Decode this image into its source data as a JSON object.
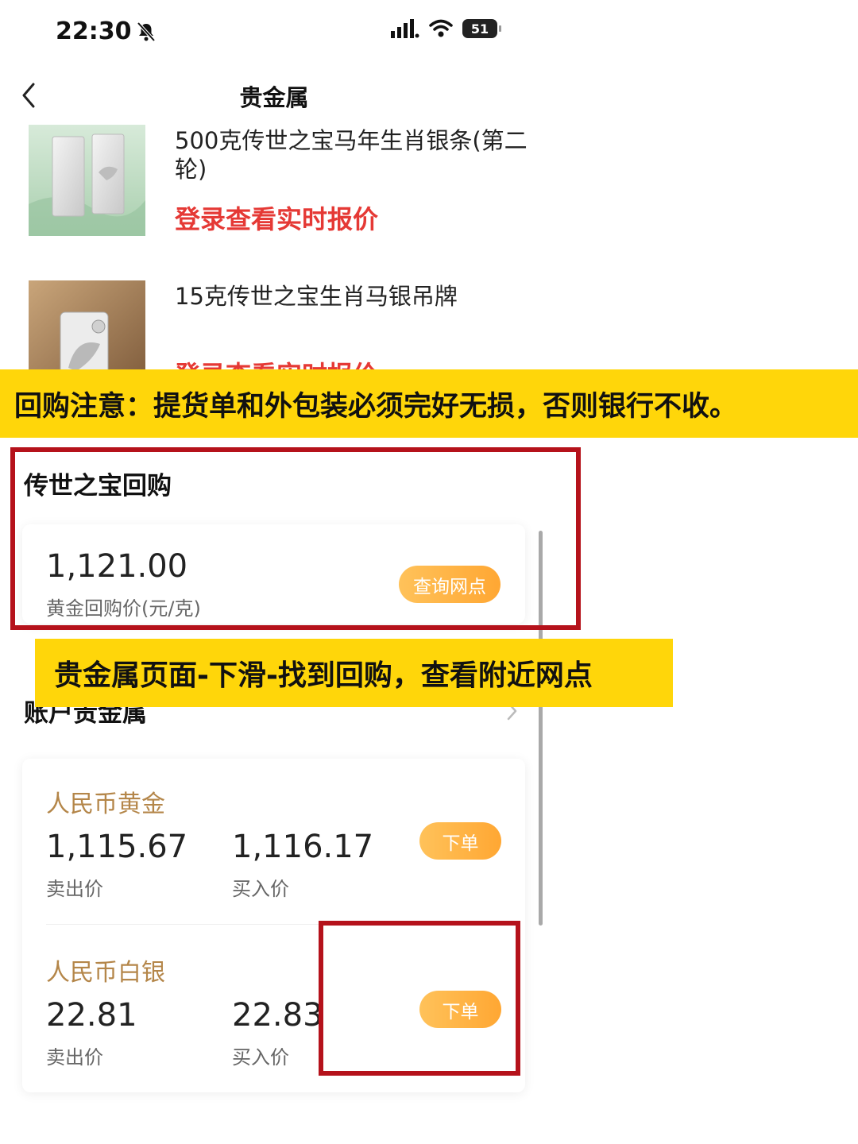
{
  "status_bar": {
    "time": "22:30",
    "battery": "51"
  },
  "nav": {
    "title": "贵金属"
  },
  "products": [
    {
      "title": "500克传世之宝马年生肖银条(第二轮)",
      "price_prompt": "登录查看实时报价"
    },
    {
      "title": "15克传世之宝生肖马银吊牌",
      "price_prompt": "登录查看实时报价"
    }
  ],
  "banners": {
    "top": "回购注意：提货单和外包装必须完好无损，否则银行不收。",
    "middle": "贵金属页面-下滑-找到回购，查看附近网点"
  },
  "buyback": {
    "section_title": "传世之宝回购",
    "price": "1,121.00",
    "price_label": "黄金回购价(元/克)",
    "button": "查询网点"
  },
  "account_metals": {
    "section_title": "账户贵金属",
    "items": [
      {
        "name": "人民币黄金",
        "sell_price": "1,115.67",
        "sell_label": "卖出价",
        "buy_price": "1,116.17",
        "buy_label": "买入价",
        "button": "下单"
      },
      {
        "name": "人民币白银",
        "sell_price": "22.81",
        "sell_label": "卖出价",
        "buy_price": "22.83",
        "buy_label": "买入价",
        "button": "下单"
      }
    ]
  },
  "colors": {
    "price_red": "#e53935",
    "banner_yellow": "#ffd60a",
    "pill_orange": "#ffad3b",
    "metal_name_brown": "#b48649",
    "highlight_red": "#b5121b"
  }
}
